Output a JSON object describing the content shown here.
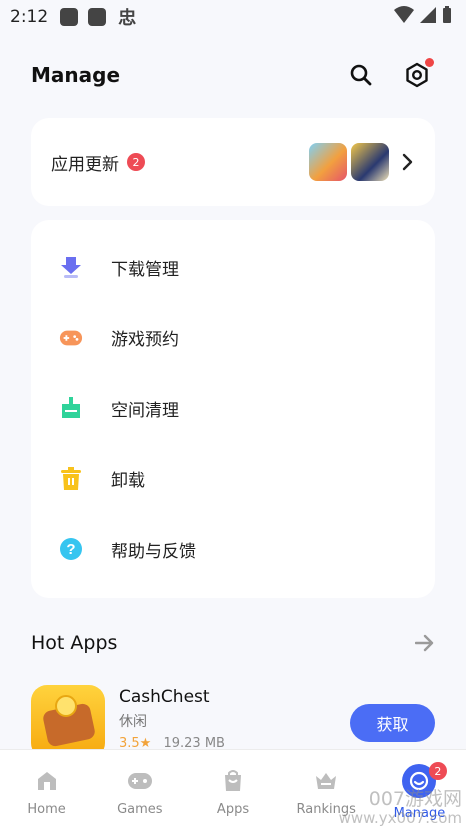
{
  "status_bar": {
    "time": "2:12",
    "glyph": "忠"
  },
  "header": {
    "title": "Manage"
  },
  "update_card": {
    "label": "应用更新",
    "badge": "2"
  },
  "menu": {
    "items": [
      {
        "label": "下载管理",
        "icon": "download-icon",
        "color": "#6a6ff0"
      },
      {
        "label": "游戏预约",
        "icon": "gamepad-icon",
        "color": "#f7955a"
      },
      {
        "label": "空间清理",
        "icon": "clean-icon",
        "color": "#2fd39a"
      },
      {
        "label": "卸载",
        "icon": "trash-icon",
        "color": "#f8c21c"
      },
      {
        "label": "帮助与反馈",
        "icon": "help-icon",
        "color": "#36c5f0"
      }
    ]
  },
  "hot_apps": {
    "title": "Hot Apps",
    "apps": [
      {
        "name": "CashChest",
        "category": "休闲",
        "rating": "3.5★",
        "size": "19.23 MB",
        "button": "获取"
      }
    ]
  },
  "tab_bar": {
    "tabs": [
      {
        "label": "Home",
        "icon": "home-icon"
      },
      {
        "label": "Games",
        "icon": "games-icon"
      },
      {
        "label": "Apps",
        "icon": "apps-icon"
      },
      {
        "label": "Rankings",
        "icon": "rankings-icon"
      },
      {
        "label": "Manage",
        "icon": "manage-icon",
        "badge": "2",
        "active": true
      }
    ]
  },
  "watermark": {
    "line1": "007游戏网",
    "line2": "www.yx007.com"
  },
  "colors": {
    "accent": "#4b6df5",
    "badge": "#ee4b55",
    "background": "#f7f8fc"
  }
}
